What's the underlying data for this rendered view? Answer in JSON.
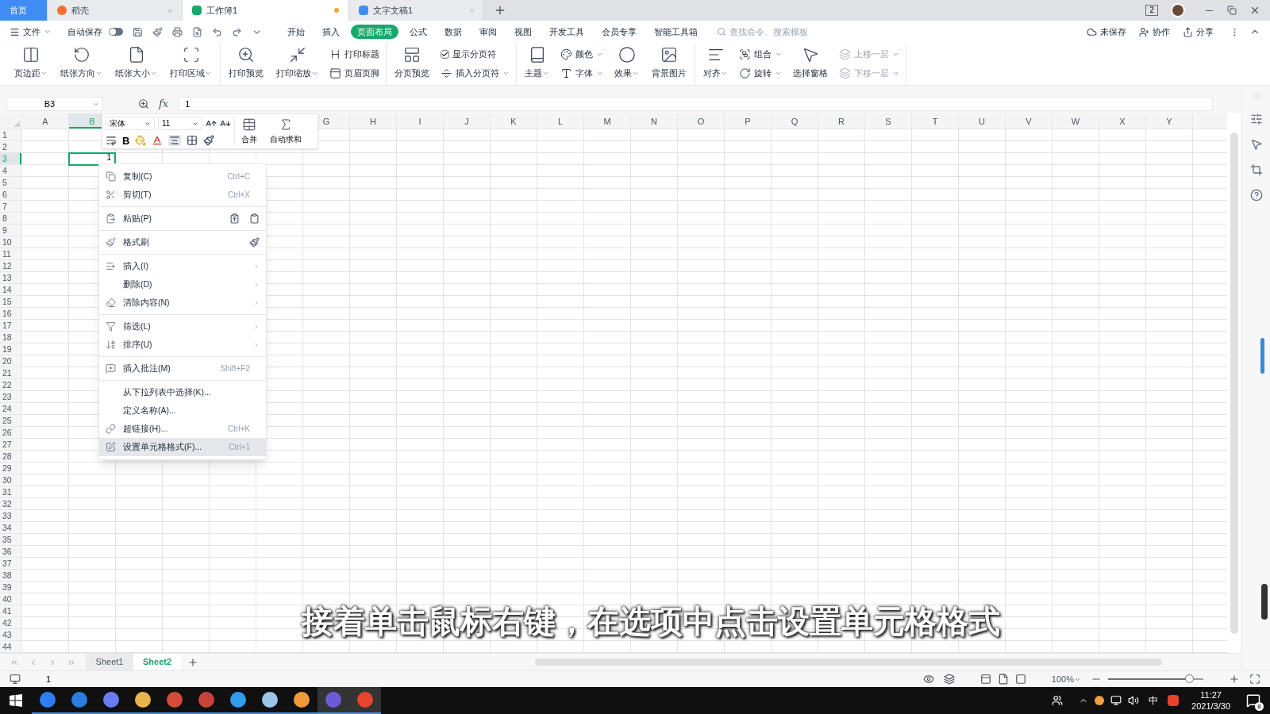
{
  "doc_tabs": [
    {
      "label": "首页",
      "kind": "home",
      "selected": false,
      "modified": false
    },
    {
      "label": "稻壳",
      "kind": "docer",
      "selected": false,
      "modified": false
    },
    {
      "label": "工作簿1",
      "kind": "sheet",
      "selected": true,
      "modified": true
    },
    {
      "label": "文字文稿1",
      "kind": "writer",
      "selected": false,
      "modified": false
    }
  ],
  "window_count": "2",
  "file_menu": "文件",
  "autosave": {
    "label": "自动保存",
    "on": false
  },
  "menu_tabs": [
    {
      "label": "开始",
      "selected": false
    },
    {
      "label": "插入",
      "selected": false
    },
    {
      "label": "页面布局",
      "selected": true
    },
    {
      "label": "公式",
      "selected": false
    },
    {
      "label": "数据",
      "selected": false
    },
    {
      "label": "审阅",
      "selected": false
    },
    {
      "label": "视图",
      "selected": false
    },
    {
      "label": "开发工具",
      "selected": false
    },
    {
      "label": "会员专享",
      "selected": false
    },
    {
      "label": "智能工具箱",
      "selected": false
    }
  ],
  "search": {
    "placeholder": "查找命令、搜索模板"
  },
  "right_actions": [
    "未保存",
    "协作",
    "分享"
  ],
  "ribbon": [
    [
      {
        "kind": "big",
        "label": "页边距",
        "dropdown": true
      },
      {
        "kind": "big",
        "label": "纸张方向",
        "dropdown": true
      },
      {
        "kind": "big",
        "label": "纸张大小",
        "dropdown": true
      },
      {
        "kind": "big",
        "label": "打印区域",
        "dropdown": true
      }
    ],
    [
      {
        "kind": "big",
        "label": "打印预览",
        "dropdown": false
      },
      {
        "kind": "big",
        "label": "打印缩放",
        "dropdown": true
      },
      {
        "kind": "stack",
        "items": [
          {
            "kind": "button",
            "label": "打印标题",
            "dropdown": false,
            "disabled": false
          },
          {
            "kind": "button",
            "label": "页眉页脚",
            "dropdown": false,
            "disabled": false
          }
        ]
      }
    ],
    [
      {
        "kind": "big",
        "label": "分页预览",
        "dropdown": false
      },
      {
        "kind": "stack",
        "items": [
          {
            "kind": "check",
            "label": "显示分页符",
            "checked": true
          },
          {
            "kind": "button",
            "label": "插入分页符",
            "dropdown": true,
            "disabled": false
          }
        ]
      }
    ],
    [
      {
        "kind": "big",
        "label": "主题",
        "dropdown": true
      },
      {
        "kind": "stack",
        "items": [
          {
            "kind": "button",
            "label": "颜色",
            "dropdown": true,
            "disabled": false
          },
          {
            "kind": "button",
            "label": "字体",
            "dropdown": true,
            "disabled": false
          }
        ]
      },
      {
        "kind": "big",
        "label": "效果",
        "dropdown": true
      },
      {
        "kind": "big",
        "label": "背景图片",
        "dropdown": false
      }
    ],
    [
      {
        "kind": "big",
        "label": "对齐",
        "dropdown": true
      },
      {
        "kind": "stack",
        "items": [
          {
            "kind": "button",
            "label": "组合",
            "dropdown": true,
            "disabled": false
          },
          {
            "kind": "button",
            "label": "旋转",
            "dropdown": true,
            "disabled": false
          }
        ]
      },
      {
        "kind": "big",
        "label": "选择窗格",
        "dropdown": false
      },
      {
        "kind": "stack",
        "items": [
          {
            "kind": "button",
            "label": "上移一层",
            "dropdown": true,
            "disabled": true
          },
          {
            "kind": "button",
            "label": "下移一层",
            "dropdown": true,
            "disabled": true
          }
        ]
      }
    ]
  ],
  "formula_bar": {
    "name_box": "B3",
    "function_label": "fx",
    "value": "1"
  },
  "columns": [
    {
      "label": "A",
      "selected": false
    },
    {
      "label": "B",
      "selected": true
    },
    {},
    {},
    {},
    {},
    {
      "label": "G",
      "selected": false
    },
    {
      "label": "H",
      "selected": false
    },
    {
      "label": "I",
      "selected": false
    },
    {
      "label": "J",
      "selected": false
    },
    {
      "label": "K",
      "selected": false
    },
    {
      "label": "L",
      "selected": false
    },
    {
      "label": "M",
      "selected": false
    },
    {
      "label": "N",
      "selected": false
    },
    {
      "label": "O",
      "selected": false
    },
    {
      "label": "P",
      "selected": false
    },
    {
      "label": "Q",
      "selected": false
    },
    {
      "label": "R",
      "selected": false
    },
    {
      "label": "S",
      "selected": false
    },
    {
      "label": "T",
      "selected": false
    },
    {
      "label": "U",
      "selected": false
    },
    {
      "label": "V",
      "selected": false
    },
    {
      "label": "W",
      "selected": false
    },
    {
      "label": "X",
      "selected": false
    },
    {
      "label": "Y",
      "selected": false
    }
  ],
  "rows": [
    {
      "label": "1",
      "selected": false
    },
    {
      "label": "2",
      "selected": false
    },
    {
      "label": "3",
      "selected": true
    },
    {
      "label": "4",
      "selected": false
    },
    {
      "label": "5",
      "selected": false
    },
    {
      "label": "6",
      "selected": false
    },
    {
      "label": "7",
      "selected": false
    },
    {
      "label": "8",
      "selected": false
    },
    {
      "label": "9",
      "selected": false
    },
    {
      "label": "10",
      "selected": false
    },
    {
      "label": "11",
      "selected": false
    },
    {
      "label": "12",
      "selected": false
    },
    {
      "label": "13",
      "selected": false
    },
    {
      "label": "14",
      "selected": false
    },
    {
      "label": "15",
      "selected": false
    },
    {
      "label": "16",
      "selected": false
    },
    {
      "label": "17",
      "selected": false
    },
    {
      "label": "18",
      "selected": false
    },
    {
      "label": "19",
      "selected": false
    },
    {
      "label": "20",
      "selected": false
    },
    {
      "label": "21",
      "selected": false
    },
    {
      "label": "22",
      "selected": false
    },
    {
      "label": "23",
      "selected": false
    },
    {
      "label": "24",
      "selected": false
    },
    {
      "label": "25",
      "selected": false
    },
    {
      "label": "26",
      "selected": false
    },
    {
      "label": "27",
      "selected": false
    },
    {
      "label": "28",
      "selected": false
    },
    {
      "label": "29",
      "selected": false
    },
    {
      "label": "30",
      "selected": false
    },
    {
      "label": "31",
      "selected": false
    },
    {
      "label": "32",
      "selected": false
    },
    {
      "label": "33",
      "selected": false
    },
    {
      "label": "34",
      "selected": false
    },
    {
      "label": "35",
      "selected": false
    },
    {
      "label": "36",
      "selected": false
    },
    {
      "label": "37",
      "selected": false
    },
    {
      "label": "38",
      "selected": false
    },
    {
      "label": "39",
      "selected": false
    },
    {
      "label": "40",
      "selected": false
    },
    {
      "label": "41",
      "selected": false
    },
    {
      "label": "42",
      "selected": false
    },
    {
      "label": "43",
      "selected": false
    },
    {
      "label": "44",
      "selected": false
    }
  ],
  "active_cell": {
    "value": "1"
  },
  "mini_toolbar": {
    "font": "宋体",
    "size": "11",
    "bold": "B",
    "merge": "合并",
    "autosum": "自动求和"
  },
  "context_menu": [
    {
      "kind": "item",
      "label": "复制(C)",
      "shortcut": "Ctrl+C",
      "submenu": false,
      "highlighted": false
    },
    {
      "kind": "item",
      "label": "剪切(T)",
      "shortcut": "Ctrl+X",
      "submenu": false,
      "highlighted": false
    },
    {
      "kind": "separator"
    },
    {
      "kind": "item",
      "label": "粘贴(P)",
      "submenu": false,
      "highlighted": false
    },
    {
      "kind": "separator"
    },
    {
      "kind": "item",
      "label": "格式刷",
      "submenu": false,
      "highlighted": false
    },
    {
      "kind": "separator"
    },
    {
      "kind": "item",
      "label": "插入(I)",
      "submenu": true,
      "highlighted": false
    },
    {
      "kind": "item",
      "label": "删除(D)",
      "submenu": true,
      "highlighted": false
    },
    {
      "kind": "item",
      "label": "清除内容(N)",
      "submenu": true,
      "highlighted": false
    },
    {
      "kind": "separator"
    },
    {
      "kind": "item",
      "label": "筛选(L)",
      "submenu": true,
      "highlighted": false
    },
    {
      "kind": "item",
      "label": "排序(U)",
      "submenu": true,
      "highlighted": false
    },
    {
      "kind": "separator"
    },
    {
      "kind": "item",
      "label": "插入批注(M)",
      "shortcut": "Shift+F2",
      "submenu": false,
      "highlighted": false
    },
    {
      "kind": "separator"
    },
    {
      "kind": "item",
      "label": "从下拉列表中选择(K)...",
      "submenu": false,
      "highlighted": false
    },
    {
      "kind": "item",
      "label": "定义名称(A)...",
      "submenu": false,
      "highlighted": false
    },
    {
      "kind": "item",
      "label": "超链接(H)...",
      "shortcut": "Ctrl+K",
      "submenu": false,
      "highlighted": false
    },
    {
      "kind": "item",
      "label": "设置单元格格式(F)...",
      "shortcut": "Ctrl+1",
      "submenu": false,
      "highlighted": true
    }
  ],
  "sheets": [
    {
      "label": "Sheet1",
      "selected": false
    },
    {
      "label": "Sheet2",
      "selected": true
    }
  ],
  "status_bar": {
    "value": "1",
    "zoom": "100%",
    "zoom_level": {
      "level": 0.85
    }
  },
  "subtitle": "接着单击鼠标右键，在选项中点击设置单元格格式",
  "taskbar": {
    "ime": "中",
    "time": "11:27",
    "date": "2021/3/30",
    "notifications": "8"
  }
}
